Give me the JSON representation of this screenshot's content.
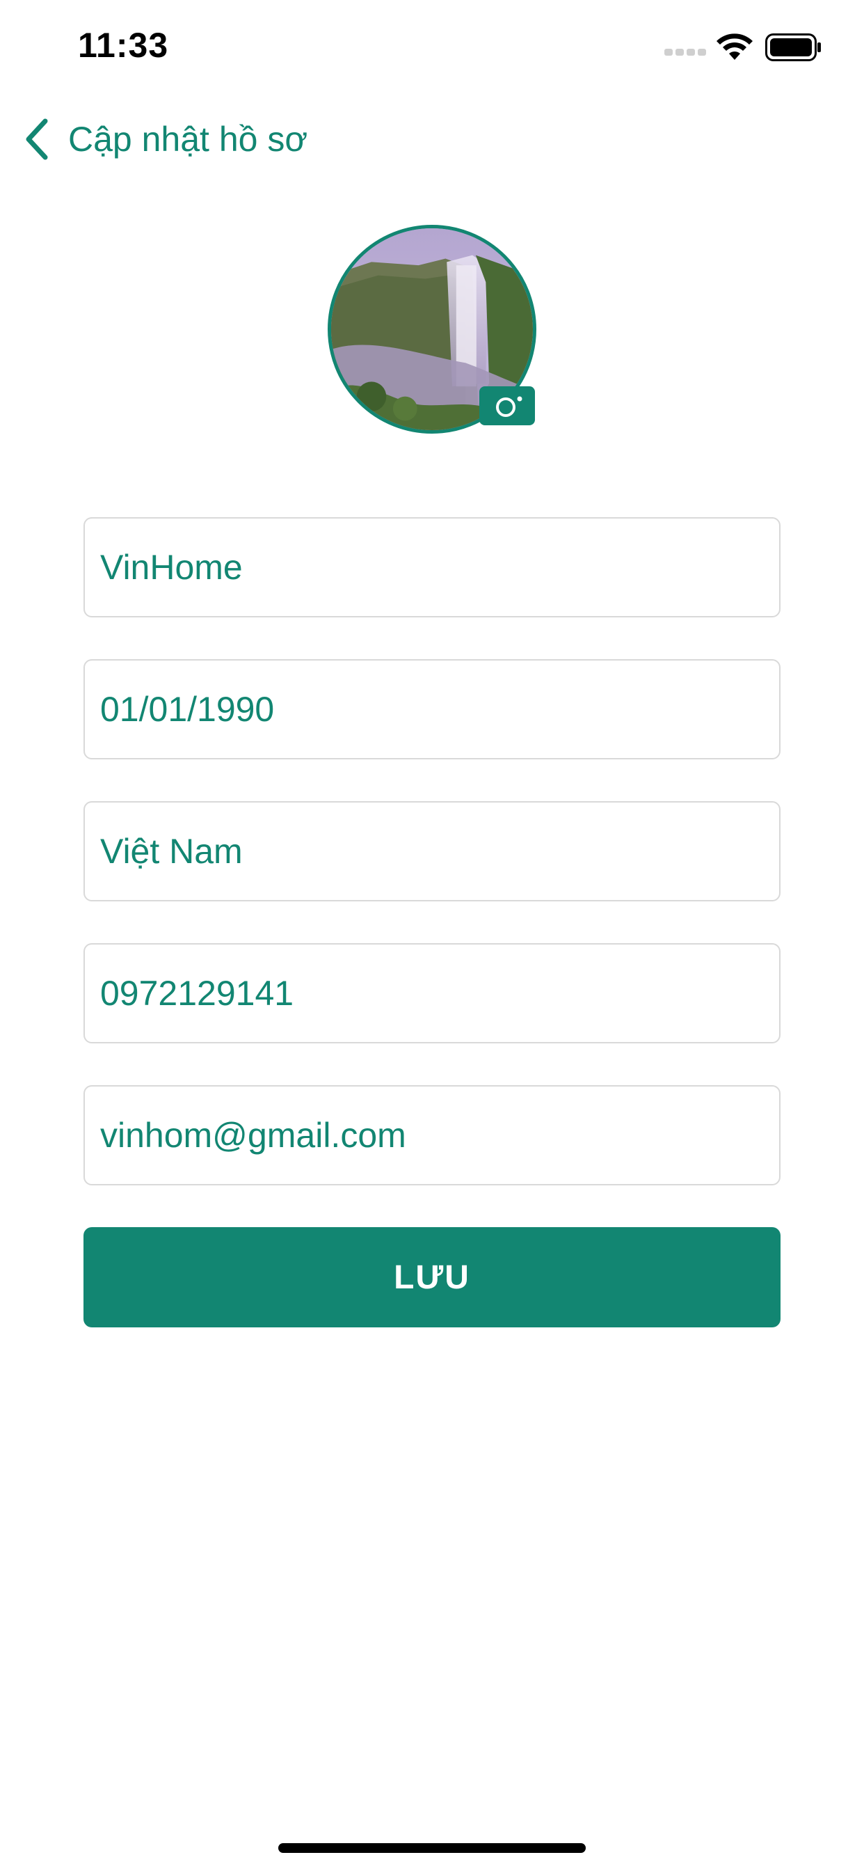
{
  "status_bar": {
    "time": "11:33",
    "icons": [
      "cellular-signal-icon",
      "wifi-icon",
      "battery-icon"
    ]
  },
  "nav": {
    "back_icon": "chevron-left-icon",
    "title": "Cập nhật hồ sơ"
  },
  "avatar": {
    "image": "waterfall-landscape-photo",
    "camera_icon": "camera-icon"
  },
  "form": {
    "fields": [
      {
        "name": "name",
        "value": "VinHome"
      },
      {
        "name": "birthday",
        "value": "01/01/1990"
      },
      {
        "name": "country",
        "value": "Việt Nam"
      },
      {
        "name": "phone",
        "value": "0972129141"
      },
      {
        "name": "email",
        "value": "vinhom@gmail.com"
      }
    ],
    "save_label": "LƯU"
  },
  "colors": {
    "accent": "#128672",
    "field_border": "#d9d9d9",
    "background": "#ffffff"
  }
}
